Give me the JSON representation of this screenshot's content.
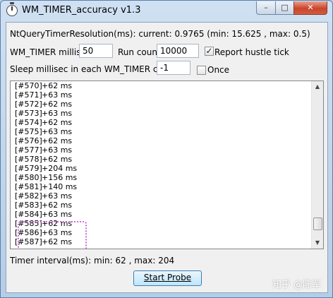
{
  "window": {
    "title": "WM_TIMER_accuracy v1.3"
  },
  "caption_buttons": {
    "minimize": "–",
    "maximize": "□",
    "close": "✕"
  },
  "resolution_line": "NtQueryTimerResolution(ms): current: 0.9765  (min: 15.625 , max: 0.5)",
  "fields": {
    "millisec_label": "WM_TIMER millisec:",
    "millisec_value": "50",
    "run_count_label": "Run count:",
    "run_count_value": "10000",
    "report_label": "Report hustle tick",
    "report_checked": "✓",
    "sleep_label": "Sleep millisec in each WM_TIMER callback:",
    "sleep_value": "-1",
    "once_label": "Once",
    "once_checked": ""
  },
  "log": [
    {
      "id": "[#570]",
      "delta": "+62 ms"
    },
    {
      "id": "[#571]",
      "delta": "+63 ms"
    },
    {
      "id": "[#572]",
      "delta": "+62 ms"
    },
    {
      "id": "[#573]",
      "delta": "+63 ms"
    },
    {
      "id": "[#574]",
      "delta": "+62 ms"
    },
    {
      "id": "[#575]",
      "delta": "+63 ms"
    },
    {
      "id": "[#576]",
      "delta": "+62 ms"
    },
    {
      "id": "[#577]",
      "delta": "+63 ms"
    },
    {
      "id": "[#578]",
      "delta": "+62 ms"
    },
    {
      "id": "[#579]",
      "delta": "+204 ms"
    },
    {
      "id": "[#580]",
      "delta": "+156 ms"
    },
    {
      "id": "[#581]",
      "delta": "+140 ms"
    },
    {
      "id": "[#582]",
      "delta": "+63 ms"
    },
    {
      "id": "[#583]",
      "delta": "+62 ms"
    },
    {
      "id": "[#584]",
      "delta": "+63 ms"
    },
    {
      "id": "[#585]",
      "delta": "+62 ms"
    },
    {
      "id": "[#586]",
      "delta": "+63 ms"
    },
    {
      "id": "[#587]",
      "delta": "+62 ms"
    }
  ],
  "scroll": {
    "up": "▲",
    "down": "▼"
  },
  "summary": "Timer interval(ms): min: 62 , max: 204",
  "start_button": "Start Probe",
  "watermark": "知乎 @陈军"
}
